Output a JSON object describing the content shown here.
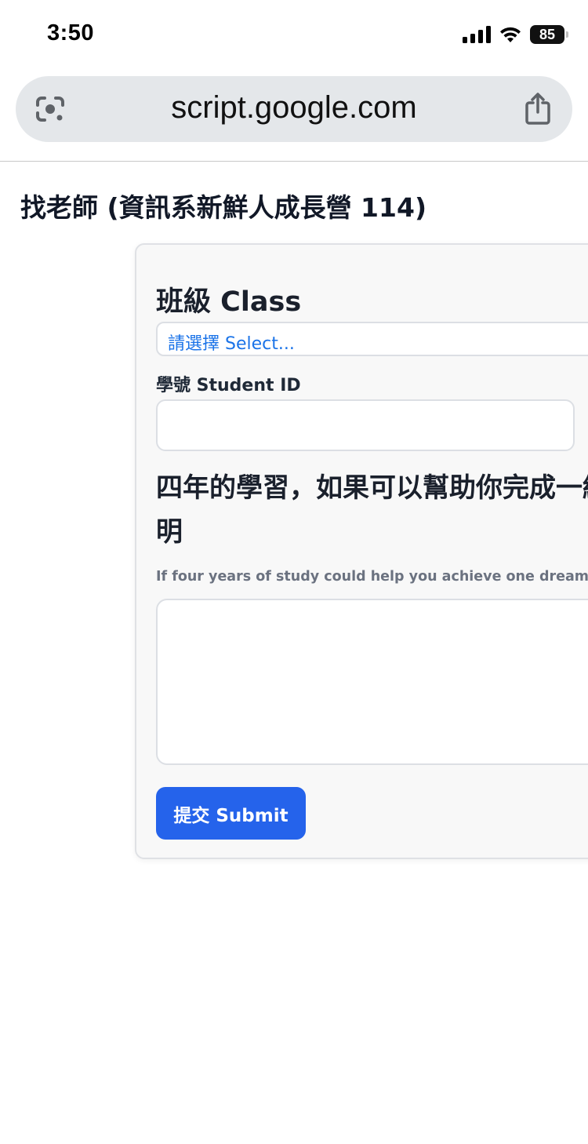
{
  "status_bar": {
    "time": "3:50",
    "battery": "85",
    "icons": [
      "cellular-signal-icon",
      "wifi-icon",
      "battery-icon"
    ]
  },
  "browser": {
    "url": "script.google.com",
    "left_icon": "google-lens-icon",
    "right_icon": "share-icon"
  },
  "page": {
    "title": "找老師 (資訊系新鮮人成長營 114)"
  },
  "form": {
    "class_heading": "班級 Class",
    "class_select": {
      "selected": "請選擇 Select..."
    },
    "student_id_label": "學號 Student ID",
    "student_id_value": "",
    "question_heading": "四年的學習，如果可以幫助你完成一細說明",
    "question_hint": "If four years of study could help you achieve one dream, wh",
    "answer_value": "",
    "submit_label": "提交 Submit"
  },
  "colors": {
    "accent": "#2563eb",
    "select_text": "#1a73e8",
    "url_bar_bg": "#e4e7ea",
    "card_bg": "#f8f8f8",
    "hint_text": "#6b7280"
  }
}
